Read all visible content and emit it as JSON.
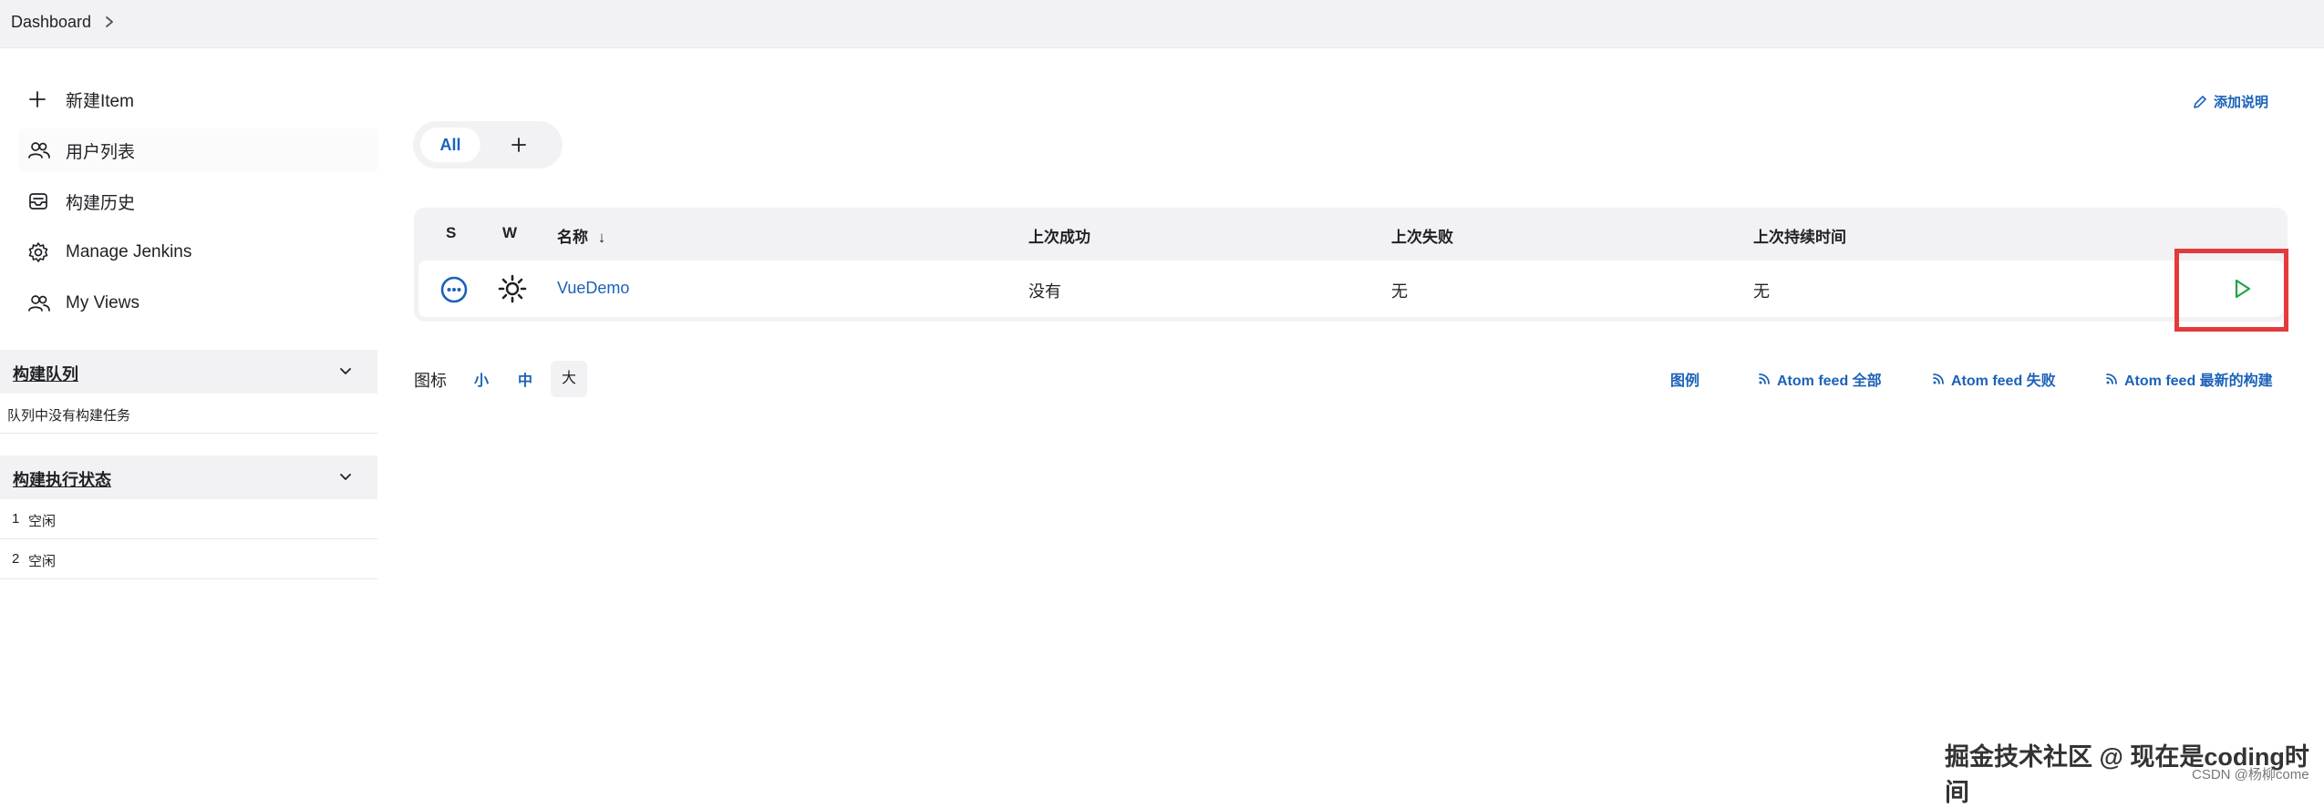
{
  "breadcrumb": {
    "root": "Dashboard"
  },
  "sidebar": {
    "items": [
      {
        "label": "新建Item",
        "icon": "plus-icon"
      },
      {
        "label": "用户列表",
        "icon": "users-icon"
      },
      {
        "label": "构建历史",
        "icon": "inbox-icon"
      },
      {
        "label": "Manage Jenkins",
        "icon": "gear-icon"
      },
      {
        "label": "My Views",
        "icon": "users-icon"
      }
    ]
  },
  "build_queue": {
    "title": "构建队列",
    "empty_text": "队列中没有构建任务"
  },
  "executor_status": {
    "title": "构建执行状态",
    "executors": [
      {
        "number": "1",
        "status": "空闲"
      },
      {
        "number": "2",
        "status": "空闲"
      }
    ]
  },
  "view_tabs": {
    "active": "All",
    "add_icon": "plus-icon"
  },
  "add_description": "添加说明",
  "job_table": {
    "headers": {
      "s": "S",
      "w": "W",
      "name": "名称",
      "sort_arrow": "↓",
      "last_success": "上次成功",
      "last_failure": "上次失败",
      "last_duration": "上次持续时间"
    },
    "rows": [
      {
        "status_icon": "status-notbuilt-icon",
        "weather_icon": "sun-icon",
        "name": "VueDemo",
        "last_success": "没有",
        "last_failure": "无",
        "last_duration": "无",
        "action_icon": "play-icon"
      }
    ]
  },
  "icon_size": {
    "label": "图标",
    "small": "小",
    "medium": "中",
    "large": "大",
    "selected": "大"
  },
  "feeds": {
    "legend": "图例",
    "all": "Atom feed 全部",
    "failures": "Atom feed 失败",
    "latest": "Atom feed 最新的构建"
  },
  "watermark": {
    "main": "掘金技术社区 @ 现在是coding时间",
    "sub": "CSDN @杨柳come"
  },
  "colors": {
    "accent": "#1b62b8",
    "build_green": "#1ea446",
    "highlight_red": "#e33b3b",
    "panel_bg": "#f2f2f4"
  }
}
